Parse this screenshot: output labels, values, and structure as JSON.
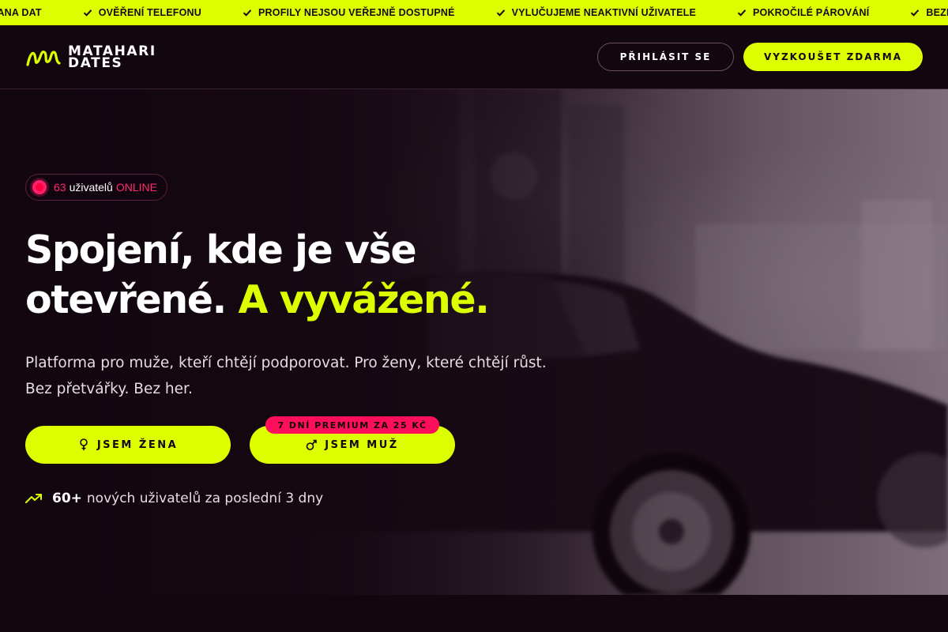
{
  "ticker": {
    "items": [
      "HRANA DAT",
      "OVĚŘENÍ TELEFONU",
      "PROFILY NEJSOU VEŘEJNĚ DOSTUPNÉ",
      "VYLUČUJEME NEAKTIVNÍ UŽIVATELE",
      "POKROČILÉ PÁROVÁNÍ",
      "BEZPLATNÝ PR"
    ],
    "icon": "check-icon"
  },
  "header": {
    "logo_line1": "MATAHARI",
    "logo_line2": "DATES",
    "login_label": "PŘIHLÁSIT SE",
    "try_label": "VYZKOUŠET ZDARMA"
  },
  "hero": {
    "online_count": "63",
    "online_word": "uživatelů",
    "online_status": "ONLINE",
    "headline_line1": "Spojení, kde je vše",
    "headline_line2_plain": "otevřené.",
    "headline_line2_accent": "A vyvážené.",
    "subtext_line1": "Platforma pro muže, kteří chtějí podporovat. Pro ženy, které chtějí růst.",
    "subtext_line2": "Bez přetvářky. Bez her.",
    "woman_button": "JSEM ŽENA",
    "man_button": "JSEM MUŽ",
    "premium_badge": "7 DNÍ PREMIUM ZA 25 KČ",
    "new_users_count": "60+",
    "new_users_text": "nových uživatelů za poslední 3 dny"
  },
  "colors": {
    "accent": "#dcff00",
    "background": "#12060f",
    "badge": "#ff0f5a",
    "online": "#ff2a6d"
  }
}
